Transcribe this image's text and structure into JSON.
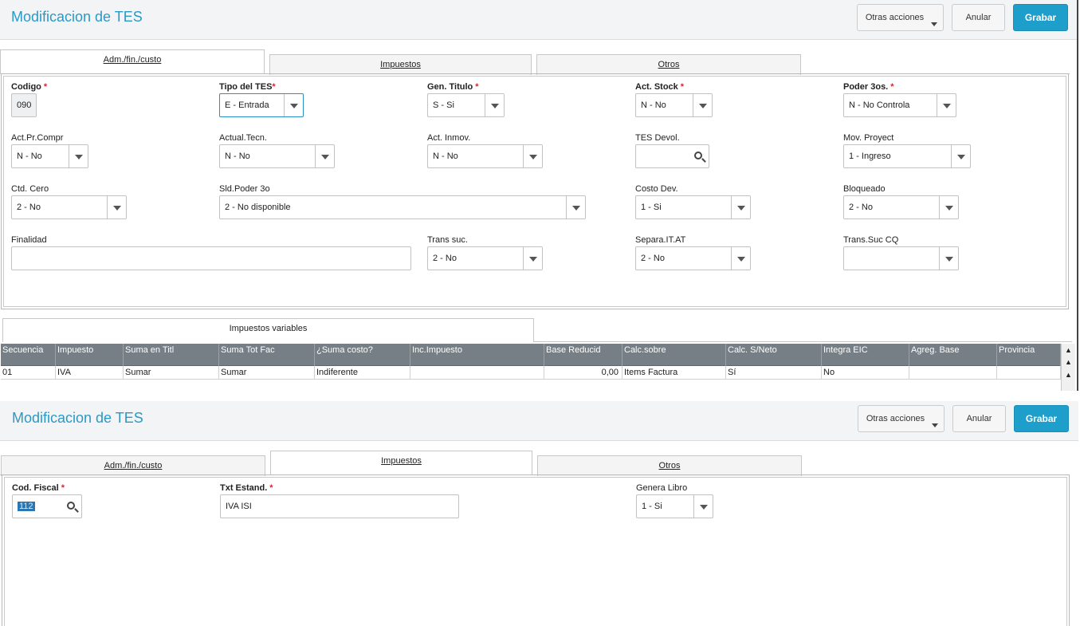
{
  "top": {
    "title": "Modificacion de TES",
    "actions": {
      "more": "Otras acciones",
      "cancel": "Anular",
      "save": "Grabar"
    },
    "tabs": [
      "Adm./fin./custo",
      "Impuestos",
      "Otros"
    ],
    "active_tab": "Adm./fin./custo",
    "fields": {
      "codigo": {
        "label": "Codigo",
        "value": "090"
      },
      "tipo_tes": {
        "label": "Tipo del TES",
        "value": "E - Entrada"
      },
      "gen_titulo": {
        "label": "Gen. Titulo",
        "value": "S - Si"
      },
      "act_stock": {
        "label": "Act. Stock",
        "value": "N - No"
      },
      "poder_3os": {
        "label": "Poder 3os.",
        "value": "N - No Controla"
      },
      "act_pr_compr": {
        "label": "Act.Pr.Compr",
        "value": "N - No"
      },
      "actual_tecn": {
        "label": "Actual.Tecn.",
        "value": "N - No"
      },
      "act_inmov": {
        "label": "Act. Inmov.",
        "value": "N - No"
      },
      "tes_devol": {
        "label": "TES Devol.",
        "value": ""
      },
      "mov_proyect": {
        "label": "Mov. Proyect",
        "value": "1 - Ingreso"
      },
      "ctd_cero": {
        "label": "Ctd. Cero",
        "value": "2 - No"
      },
      "sld_poder_3o": {
        "label": "Sld.Poder 3o",
        "value": "2 - No disponible"
      },
      "costo_dev": {
        "label": "Costo Dev.",
        "value": "1 - Si"
      },
      "bloqueado": {
        "label": "Bloqueado",
        "value": "2 - No"
      },
      "finalidad": {
        "label": "Finalidad",
        "value": ""
      },
      "trans_suc": {
        "label": "Trans suc.",
        "value": "2 - No"
      },
      "separa_it_at": {
        "label": "Separa.IT.AT",
        "value": "2 - No"
      },
      "trans_suc_cq": {
        "label": "Trans.Suc CQ",
        "value": ""
      }
    },
    "sub_tab": "Impuestos variables",
    "grid": {
      "columns": [
        "Secuencia",
        "Impuesto",
        "Suma en Titl",
        "Suma Tot Fac",
        "¿Suma costo?",
        "Inc.Impuesto",
        "Base Reducid",
        "Calc.sobre",
        "Calc. S/Neto",
        "Integra EIC",
        "Agreg. Base",
        "Provincia"
      ],
      "rows": [
        [
          "01",
          "IVA",
          "Sumar",
          "Sumar",
          "Indiferente",
          "",
          "0,00",
          "Items Factura",
          "Sí",
          "No",
          "",
          ""
        ]
      ]
    }
  },
  "bottom": {
    "title": "Modificacion de TES",
    "actions": {
      "more": "Otras acciones",
      "cancel": "Anular",
      "save": "Grabar"
    },
    "tabs": [
      "Adm./fin./custo",
      "Impuestos",
      "Otros"
    ],
    "active_tab": "Impuestos",
    "fields": {
      "cod_fiscal": {
        "label": "Cod. Fiscal",
        "value": "112"
      },
      "txt_estand": {
        "label": "Txt Estand.",
        "value": "IVA ISI"
      },
      "genera_libro": {
        "label": "Genera Libro",
        "value": "1 - Si"
      }
    }
  },
  "required_mark": "*"
}
